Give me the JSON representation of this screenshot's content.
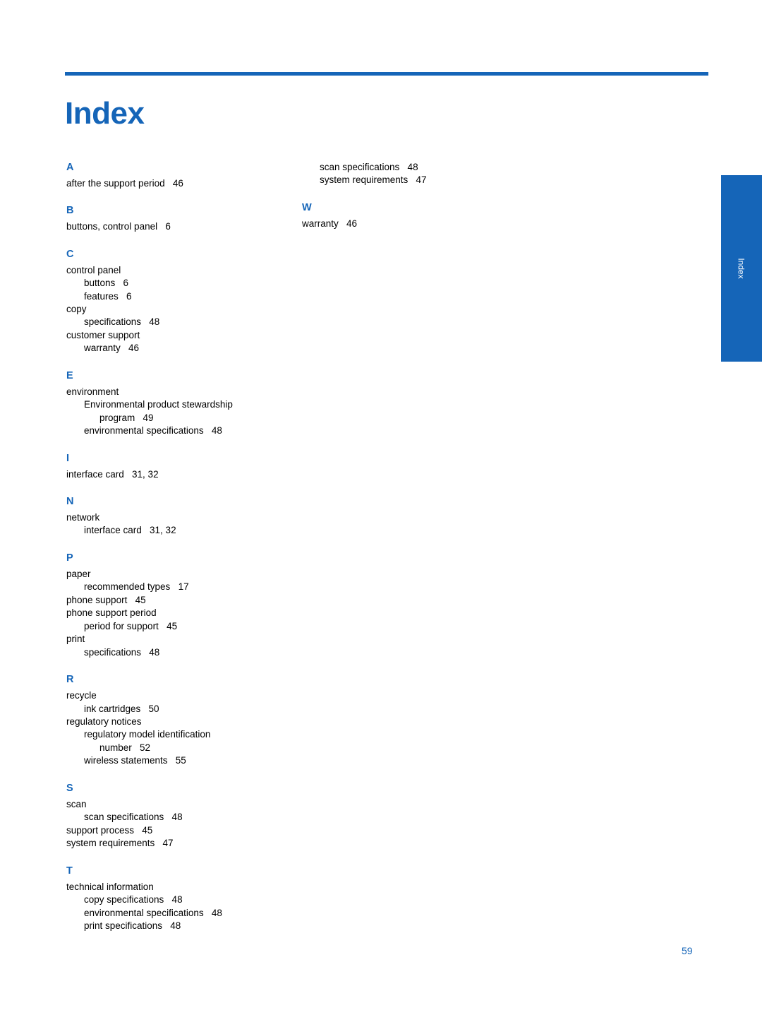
{
  "document": {
    "title": "Index",
    "page_number": "59",
    "side_tab_label": "Index",
    "accent_color": "#1565b8"
  },
  "columns": [
    {
      "id": "left",
      "sections": [
        {
          "letter": "A",
          "entries": [
            {
              "level": 1,
              "text": "after the support period   46"
            }
          ]
        },
        {
          "letter": "B",
          "entries": [
            {
              "level": 1,
              "text": "buttons, control panel   6"
            }
          ]
        },
        {
          "letter": "C",
          "entries": [
            {
              "level": 1,
              "text": "control panel"
            },
            {
              "level": 2,
              "text": "buttons   6"
            },
            {
              "level": 2,
              "text": "features   6"
            },
            {
              "level": 1,
              "text": "copy"
            },
            {
              "level": 2,
              "text": "specifications   48"
            },
            {
              "level": 1,
              "text": "customer support"
            },
            {
              "level": 2,
              "text": "warranty   46"
            }
          ]
        },
        {
          "letter": "E",
          "entries": [
            {
              "level": 1,
              "text": "environment"
            },
            {
              "level": 2,
              "text": "Environmental product stewardship"
            },
            {
              "level": 3,
              "text": "program   49"
            },
            {
              "level": 2,
              "text": "environmental specifications   48"
            }
          ]
        },
        {
          "letter": "I",
          "entries": [
            {
              "level": 1,
              "text": "interface card   31, 32"
            }
          ]
        },
        {
          "letter": "N",
          "entries": [
            {
              "level": 1,
              "text": "network"
            },
            {
              "level": 2,
              "text": "interface card   31, 32"
            }
          ]
        },
        {
          "letter": "P",
          "entries": [
            {
              "level": 1,
              "text": "paper"
            },
            {
              "level": 2,
              "text": "recommended types   17"
            },
            {
              "level": 1,
              "text": "phone support   45"
            },
            {
              "level": 1,
              "text": "phone support period"
            },
            {
              "level": 2,
              "text": "period for support   45"
            },
            {
              "level": 1,
              "text": "print"
            },
            {
              "level": 2,
              "text": "specifications   48"
            }
          ]
        },
        {
          "letter": "R",
          "entries": [
            {
              "level": 1,
              "text": "recycle"
            },
            {
              "level": 2,
              "text": "ink cartridges   50"
            },
            {
              "level": 1,
              "text": "regulatory notices"
            },
            {
              "level": 2,
              "text": "regulatory model identification"
            },
            {
              "level": 3,
              "text": "number   52"
            },
            {
              "level": 2,
              "text": "wireless statements   55"
            }
          ]
        },
        {
          "letter": "S",
          "entries": [
            {
              "level": 1,
              "text": "scan"
            },
            {
              "level": 2,
              "text": "scan specifications   48"
            },
            {
              "level": 1,
              "text": "support process   45"
            },
            {
              "level": 1,
              "text": "system requirements   47"
            }
          ]
        },
        {
          "letter": "T",
          "entries": [
            {
              "level": 1,
              "text": "technical information"
            },
            {
              "level": 2,
              "text": "copy specifications   48"
            },
            {
              "level": 2,
              "text": "environmental specifications   48"
            },
            {
              "level": 2,
              "text": "print specifications   48"
            }
          ]
        }
      ]
    },
    {
      "id": "right",
      "sections": [
        {
          "letter": "",
          "entries": [
            {
              "level": 2,
              "text": "scan specifications   48"
            },
            {
              "level": 2,
              "text": "system requirements   47"
            }
          ]
        },
        {
          "letter": "W",
          "entries": [
            {
              "level": 1,
              "text": "warranty   46"
            }
          ]
        }
      ]
    }
  ]
}
